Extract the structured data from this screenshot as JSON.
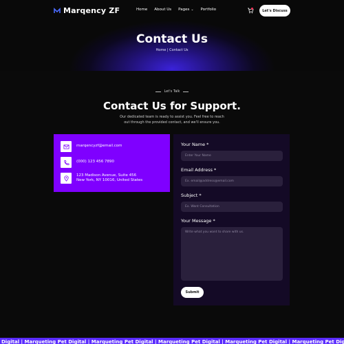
{
  "colors": {
    "accent": "#7f00ff",
    "form_bg": "#140a26",
    "marquee_bg": "#5b2cff",
    "page_bg": "#0a0a0a"
  },
  "nav": {
    "brand": "Marqency ZF",
    "links": [
      {
        "label": "Home"
      },
      {
        "label": "About Us"
      },
      {
        "label": "Pages",
        "icon": "chevron-down-icon"
      },
      {
        "label": "Portfolio"
      }
    ],
    "cta_label": "Let's Discuss"
  },
  "hero": {
    "title": "Contact Us",
    "breadcrumb": "Home | Contact Us"
  },
  "section": {
    "eyebrow": "Let's Talk",
    "title": "Contact Us for Support.",
    "subtitle": "Our dedicated team is ready to assist you. Feel free to reach out through the provided contact, and we'll ensure you."
  },
  "contact_info": {
    "email": "marqencyzf@email.com",
    "phone": "(000) 123 456 7890",
    "address_line1": "123 Madison Avenue, Suite 456",
    "address_line2": "New York, NY 10016, United States"
  },
  "form": {
    "name_label": "Your Name *",
    "name_placeholder": "Enter Your Name",
    "email_label": "Email Address *",
    "email_placeholder": "Ex. email@address@email.com",
    "subject_label": "Subject *",
    "subject_placeholder": "Ex. Want Consultation",
    "message_label": "Your Message *",
    "message_placeholder": "Write what you want to share with us.",
    "submit_label": "Submit"
  },
  "marquee": {
    "text": "Digital | Marqueting Pet Digital | Marqueting Pet Digital | Marqueting Pet Digital | Marqueting Pet Digital | Marqueting Pet Digital"
  }
}
